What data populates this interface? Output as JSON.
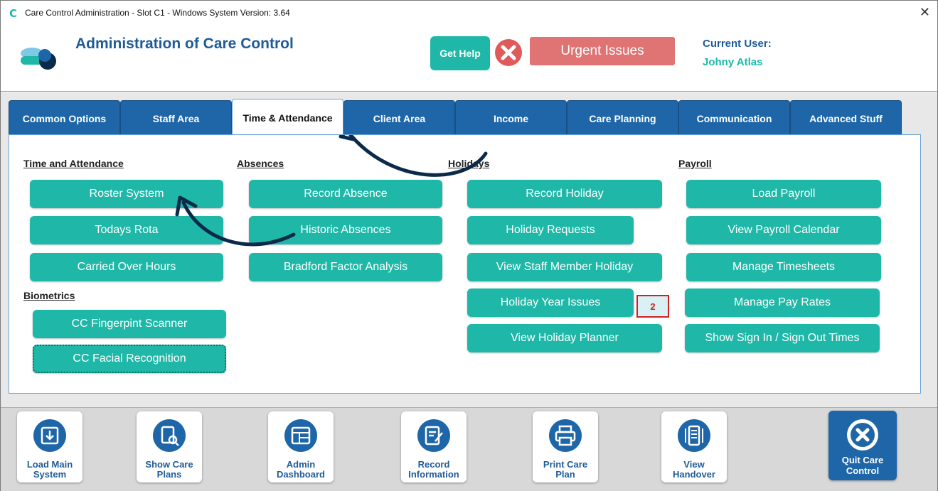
{
  "window": {
    "title": "Care Control Administration - Slot C1 - Windows System Version: 3.64",
    "app_icon": "C",
    "close": "✕"
  },
  "header": {
    "title": "Administration of Care Control",
    "help_label": "Get Help",
    "urgent_label": "Urgent Issues",
    "user_label": "Current User:",
    "user_name": "Johny Atlas"
  },
  "tabs": [
    "Common Options",
    "Staff Area",
    "Time & Attendance",
    "Client Area",
    "Income",
    "Care Planning",
    "Communication",
    "Advanced Stuff"
  ],
  "active_tab": "Time & Attendance",
  "sections": {
    "time_attendance": {
      "title": "Time and Attendance",
      "buttons": [
        "Roster System",
        "Todays Rota",
        "Carried Over Hours"
      ]
    },
    "biometrics": {
      "title": "Biometrics",
      "buttons": [
        "CC Fingerpint Scanner",
        "CC Facial Recognition"
      ]
    },
    "absences": {
      "title": "Absences",
      "buttons": [
        "Record Absence",
        "Historic Absences",
        "Bradford Factor Analysis"
      ]
    },
    "holidays": {
      "title": "Holidays",
      "buttons": [
        "Record Holiday",
        "Holiday Requests",
        "View Staff Member Holiday",
        "Holiday Year Issues",
        "View Holiday Planner"
      ],
      "badge": "2"
    },
    "payroll": {
      "title": "Payroll",
      "buttons": [
        "Load Payroll",
        "View Payroll Calendar",
        "Manage Timesheets",
        "Manage Pay Rates",
        "Show Sign In / Sign Out Times"
      ]
    }
  },
  "toolbar": [
    {
      "label": "Load Main\nSystem",
      "icon": "download-box-icon"
    },
    {
      "label": "Show Care\nPlans",
      "icon": "document-search-icon"
    },
    {
      "label": "Admin\nDashboard",
      "icon": "dashboard-icon"
    },
    {
      "label": "Record\nInformation",
      "icon": "edit-document-icon"
    },
    {
      "label": "Print Care\nPlan",
      "icon": "printer-icon"
    },
    {
      "label": "View\nHandover",
      "icon": "handover-list-icon"
    }
  ],
  "quit": {
    "label": "Quit Care\nControl",
    "icon": "close-circle-icon"
  },
  "colors": {
    "teal": "#1fb8a8",
    "blue": "#1e66a8",
    "urgent": "#e07373",
    "title_blue": "#1f5b96"
  }
}
